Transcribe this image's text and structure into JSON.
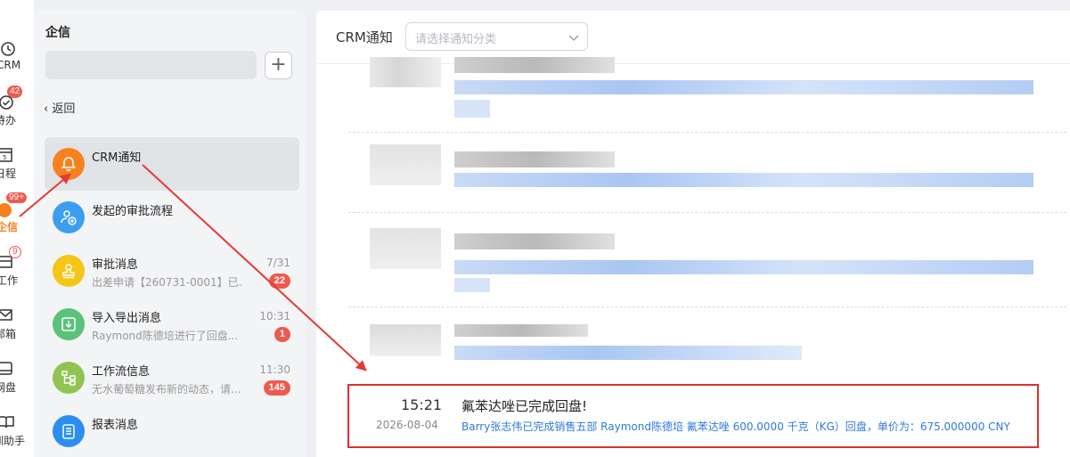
{
  "rail": {
    "items": [
      {
        "label": "CRM",
        "icon": "clock-icon",
        "badge": ""
      },
      {
        "label": "待办",
        "icon": "check-circle-icon",
        "badge": "42"
      },
      {
        "label": "日程",
        "icon": "calendar-icon",
        "badge": ""
      },
      {
        "label": "企信",
        "icon": "chat-icon",
        "badge": "99+"
      },
      {
        "label": "工作",
        "icon": "briefcase-icon",
        "badge": "9"
      },
      {
        "label": "邮箱",
        "icon": "mail-icon",
        "badge": ""
      },
      {
        "label": "网盘",
        "icon": "disk-icon",
        "badge": ""
      },
      {
        "label": "训助手",
        "icon": "book-icon",
        "badge": ""
      }
    ],
    "active_color": "#f5821f"
  },
  "middle": {
    "title": "企信",
    "add_label": "+",
    "back_label": "返回",
    "items": [
      {
        "title": "CRM通知",
        "sub": "",
        "time": "",
        "badge": "",
        "icon": "bell-icon",
        "color": "#f5821f"
      },
      {
        "title": "发起的审批流程",
        "sub": "",
        "time": "",
        "badge": "",
        "icon": "user-add-icon",
        "color": "#3c9ef0"
      },
      {
        "title": "审批消息",
        "sub": "出差申请【260731-0001】已...",
        "time": "7/31",
        "badge": "22",
        "icon": "stamp-icon",
        "color": "#f5c617"
      },
      {
        "title": "导入导出消息",
        "sub": "Raymond陈德培进行了回盘...",
        "time": "10:31",
        "badge": "1",
        "icon": "download-icon",
        "color": "#5bc27a"
      },
      {
        "title": "工作流信息",
        "sub": "无水葡萄糖发布新的动态，请...",
        "time": "11:30",
        "badge": "145",
        "icon": "flow-icon",
        "color": "#8fc452"
      },
      {
        "title": "报表消息",
        "sub": "",
        "time": "",
        "badge": "",
        "icon": "report-icon",
        "color": "#2b8ef0"
      }
    ]
  },
  "right": {
    "title": "CRM通知",
    "select_placeholder": "请选择通知分类",
    "message": {
      "time": "15:21",
      "date": "2026-08-04",
      "title": "氟苯达唑已完成回盘!",
      "body": "Barry张志伟已完成销售五部 Raymond陈德培 氟苯达唑 600.0000 千克（KG）回盘，单价为：675.000000 CNY"
    }
  },
  "colors": {
    "highlight_border": "#d9322c",
    "link_blue": "#2e7bd6",
    "badge_red": "#ee5a4e"
  }
}
